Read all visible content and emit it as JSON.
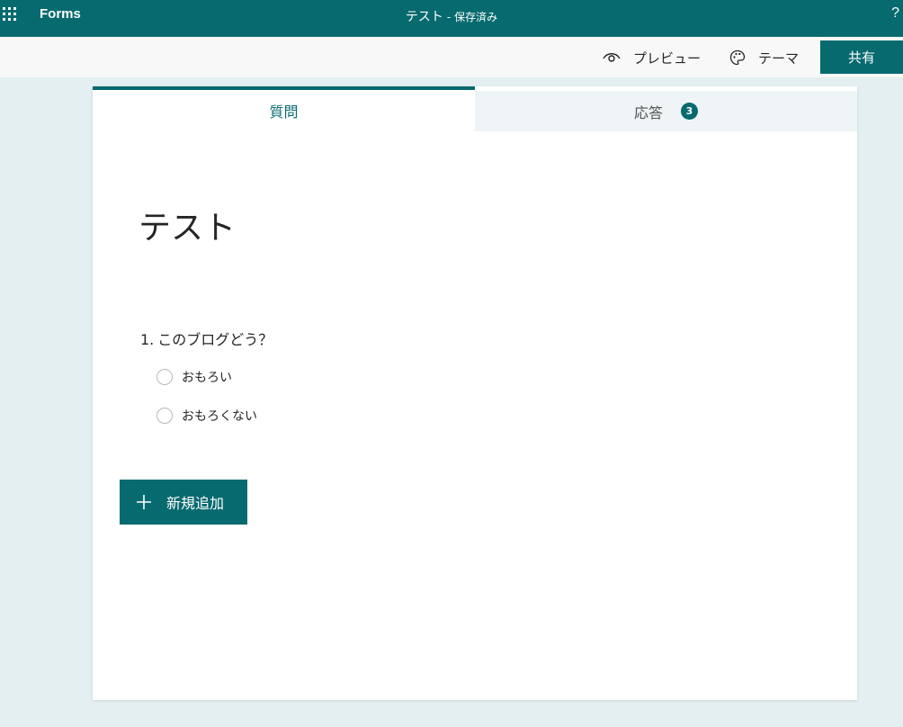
{
  "topbar": {
    "app_name": "Forms",
    "doc_title": "テスト",
    "separator": "-",
    "save_status": "保存済み",
    "help_label": "?"
  },
  "commands": {
    "preview_label": "プレビュー",
    "theme_label": "テーマ",
    "share_label": "共有"
  },
  "tabs": {
    "questions_label": "質問",
    "responses_label": "応答",
    "responses_count": "3"
  },
  "form": {
    "title": "テスト",
    "question": {
      "number": "1.",
      "text": "このブログどう？",
      "options": [
        "おもろい",
        "おもろくない"
      ]
    },
    "add_new_label": "新規追加"
  },
  "colors": {
    "brand": "#076a6f",
    "background": "#e3eff1"
  }
}
